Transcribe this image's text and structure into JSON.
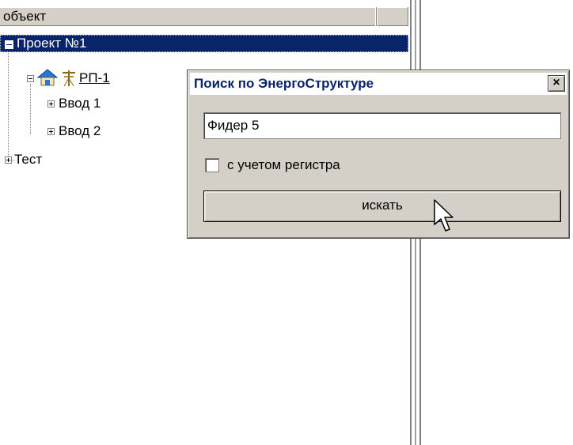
{
  "tree": {
    "header": {
      "column_label": "объект"
    },
    "nodes": [
      {
        "label": "Проект №1"
      },
      {
        "label": "РП-1"
      },
      {
        "label": "Ввод 1"
      },
      {
        "label": "Ввод 2"
      },
      {
        "label": "Тест"
      }
    ]
  },
  "dialog": {
    "title": "Поиск по ЭнергоСтруктуре",
    "close_label": "×",
    "search_value": "Фидер 5",
    "case_sensitive_label": "с учетом регистра",
    "search_button_label": "искать"
  },
  "colors": {
    "selection": "#0a246a",
    "face": "#d4d0c8"
  },
  "icons": [
    "expand-icon",
    "collapse-icon",
    "house-icon",
    "power-pole-icon",
    "close-icon",
    "mouse-pointer-icon"
  ]
}
